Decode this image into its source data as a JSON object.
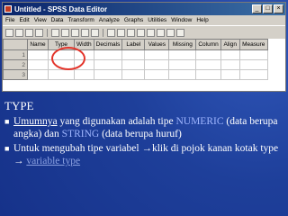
{
  "window": {
    "title": "Untitled - SPSS Data Editor",
    "controls": [
      "_",
      "□",
      "×"
    ]
  },
  "menu": [
    "File",
    "Edit",
    "View",
    "Data",
    "Transform",
    "Analyze",
    "Graphs",
    "Utilities",
    "Window",
    "Help"
  ],
  "grid": {
    "headers": [
      "Name",
      "Type",
      "Width",
      "Decimals",
      "Label",
      "Values",
      "Missing",
      "Column",
      "Align",
      "Measure"
    ],
    "rows": [
      "1",
      "2",
      "3"
    ]
  },
  "slide": {
    "heading": "TYPE",
    "b1_u": "Umumnya",
    "b1_a": " yang digunakan adalah tipe ",
    "b1_kw1": "NUMERIC",
    "b1_b": " (data berupa angka) dan ",
    "b1_kw2": "STRING",
    "b1_c": " (data berupa huruf)",
    "b2_a": "Untuk mengubah tipe variabel ",
    "b2_arrow1": "→",
    "b2_b": "klik di pojok kanan kotak type ",
    "b2_arrow2": "→",
    "b2_c": " ",
    "b2_kw": "variable type"
  },
  "colors": {
    "accent": "#e3342a",
    "background": "#1e3f9a"
  }
}
